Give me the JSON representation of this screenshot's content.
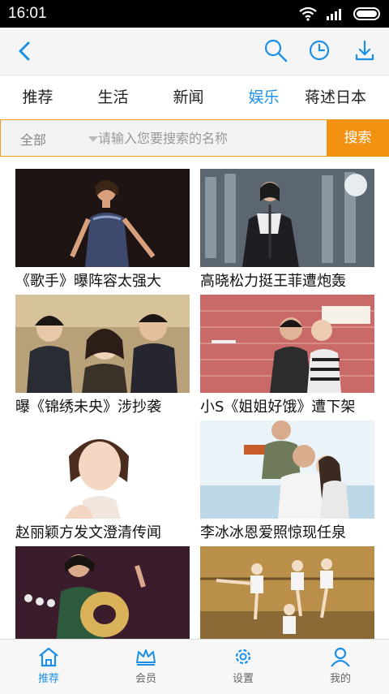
{
  "status_bar": {
    "time": "16:01"
  },
  "tabs": [
    {
      "label": "推荐"
    },
    {
      "label": "生活"
    },
    {
      "label": "新闻"
    },
    {
      "label": "娱乐"
    },
    {
      "label": "蒋述日本"
    }
  ],
  "search": {
    "category": "全部",
    "placeholder": "请输入您要搜索的名称",
    "button_label": "搜索"
  },
  "items": [
    {
      "caption": "《歌手》曝阵容太强大"
    },
    {
      "caption": "高晓松力挺王菲遭炮轰"
    },
    {
      "caption": "曝《锦绣未央》涉抄袭"
    },
    {
      "caption": "小S《姐姐好饿》遭下架"
    },
    {
      "caption": "赵丽颖方发文澄清传闻"
    },
    {
      "caption": "李冰冰恩爱照惊现任泉"
    },
    {
      "caption": ""
    },
    {
      "caption": ""
    }
  ],
  "bottom_nav": [
    {
      "label": "推荐",
      "icon": "home-icon"
    },
    {
      "label": "会员",
      "icon": "crown-icon"
    },
    {
      "label": "设置",
      "icon": "gear-icon"
    },
    {
      "label": "我的",
      "icon": "user-icon"
    }
  ],
  "colors": {
    "accent": "#1b8fe6",
    "search_button": "#f39212"
  }
}
